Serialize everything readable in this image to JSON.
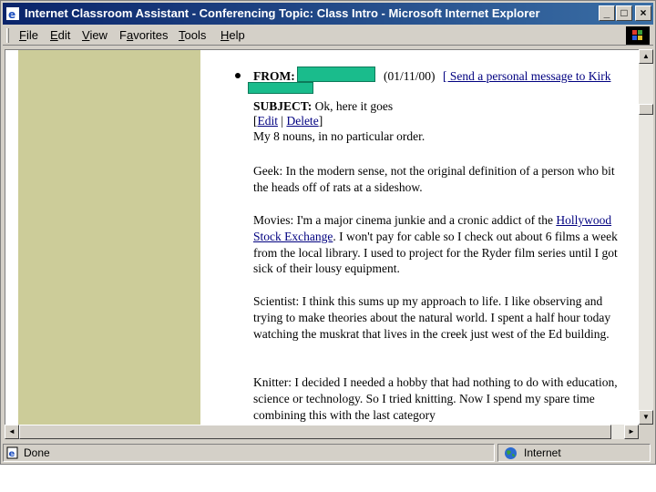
{
  "window": {
    "title": "Internet Classroom Assistant - Conferencing Topic: Class Intro - Microsoft Internet Explorer",
    "minimize": "_",
    "maximize": "□",
    "close": "×"
  },
  "menu": {
    "items": [
      {
        "u": "F",
        "rest": "ile"
      },
      {
        "u": "E",
        "rest": "dit"
      },
      {
        "u": "V",
        "rest": "iew"
      },
      {
        "pre": "F",
        "u": "a",
        "rest": "vorites"
      },
      {
        "u": "T",
        "rest": "ools"
      },
      {
        "u": "H",
        "rest": "elp"
      }
    ]
  },
  "post": {
    "from_label": "FROM:",
    "date": "(01/11/00)",
    "send_link": "[ Send a personal message to Kirk",
    "subject_label": "SUBJECT:",
    "subject": "Ok, here it goes",
    "edit_link": "Edit",
    "delete_link": "Delete",
    "bracket_open": "[",
    "pipe": "|",
    "bracket_close": "]",
    "intro": "My 8 nouns, in no particular order.",
    "p1": "Geek: In the modern sense, not the original definition of a person who bit the heads off of rats at a sideshow.",
    "p2_before": "Movies: I'm a major cinema junkie and a cronic addict of the ",
    "p2_link": "Hollywood Stock Exchange",
    "p2_after": ". I won't pay for cable so I check out about 6 films a week from the local library. I used to project for the Ryder film series until I got sick of their lousy equipment.",
    "p3": "Scientist: I think this sums up my approach to life. I like observing and trying to make theories about the natural world. I spent a half hour today watching the muskrat that lives in the creek just west of the Ed building.",
    "p4": "Knitter: I decided I needed a hobby that had nothing to do with education, science or technology. So I tried knitting. Now I spend my spare time combining this with the last category"
  },
  "scrollbars": {
    "up": "▲",
    "down": "▼",
    "left": "◄",
    "right": "►"
  },
  "status": {
    "left": "Done",
    "zone": "Internet"
  },
  "colors": {
    "left_pane": "#cccc99",
    "redaction": "#1abc8c",
    "titlebar": "#0a246a"
  }
}
